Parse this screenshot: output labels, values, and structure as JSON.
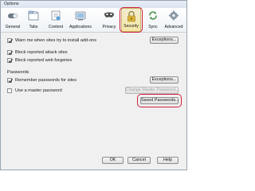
{
  "window": {
    "title": "Options"
  },
  "toolbar": {
    "items": [
      {
        "label": "General",
        "icon": "general-switch-icon"
      },
      {
        "label": "Tabs",
        "icon": "tabs-icon"
      },
      {
        "label": "Content",
        "icon": "content-icon"
      },
      {
        "label": "Applications",
        "icon": "applications-icon"
      },
      {
        "label": "Privacy",
        "icon": "privacy-mask-icon"
      },
      {
        "label": "Security",
        "icon": "security-padlock-icon",
        "selected": true
      },
      {
        "label": "Sync",
        "icon": "sync-icon"
      },
      {
        "label": "Advanced",
        "icon": "advanced-gear-icon"
      }
    ]
  },
  "security": {
    "warn_addons": {
      "label": "Warn me when sites try to install add-ons",
      "checked": true
    },
    "addons_exceptions_label": "Exceptions...",
    "block_attack": {
      "label": "Block reported attack sites",
      "checked": true
    },
    "block_forgeries": {
      "label": "Block reported web forgeries",
      "checked": true
    }
  },
  "passwords": {
    "section_title": "Passwords",
    "remember": {
      "label": "Remember passwords for sites",
      "checked": true
    },
    "exceptions_label": "Exceptions...",
    "master": {
      "label": "Use a master password",
      "checked": false
    },
    "change_master_label": "Change Master Password...",
    "saved_passwords_label": "Saved Passwords..."
  },
  "footer": {
    "ok_label": "OK",
    "cancel_label": "Cancel",
    "help_label": "Help"
  },
  "colors": {
    "highlight_ring": "#d0203a",
    "selected_tab": "#f6e7a6"
  }
}
